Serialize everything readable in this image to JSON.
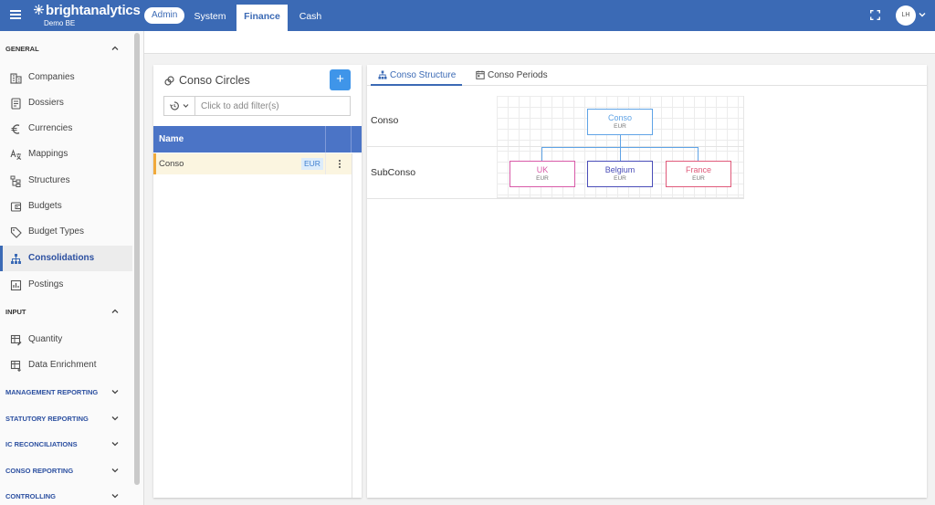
{
  "brand": {
    "name": "brightanalytics",
    "subtitle": "Demo BE"
  },
  "topbar": {
    "admin_label": "Admin",
    "tabs": [
      {
        "label": "System",
        "active": false
      },
      {
        "label": "Finance",
        "active": true
      },
      {
        "label": "Cash",
        "active": false
      }
    ],
    "user_initials": "LH"
  },
  "sidebar": {
    "general_title": "GENERAL",
    "general_items": [
      {
        "label": "Companies",
        "icon": "building-icon"
      },
      {
        "label": "Dossiers",
        "icon": "document-list-icon"
      },
      {
        "label": "Currencies",
        "icon": "euro-icon"
      },
      {
        "label": "Mappings",
        "icon": "translate-icon"
      },
      {
        "label": "Structures",
        "icon": "file-tree-icon"
      },
      {
        "label": "Budgets",
        "icon": "wallet-icon"
      },
      {
        "label": "Budget Types",
        "icon": "tag-icon"
      },
      {
        "label": "Consolidations",
        "icon": "hierarchy-icon",
        "active": true
      },
      {
        "label": "Postings",
        "icon": "chart-box-icon"
      }
    ],
    "input_title": "INPUT",
    "input_items": [
      {
        "label": "Quantity",
        "icon": "table-edit-icon"
      },
      {
        "label": "Data Enrichment",
        "icon": "table-plus-icon"
      }
    ],
    "collapsed_sections": [
      "MANAGEMENT REPORTING",
      "STATUTORY REPORTING",
      "IC RECONCILIATIONS",
      "CONSO REPORTING",
      "CONTROLLING"
    ]
  },
  "left_panel": {
    "title": "Conso Circles",
    "add_label": "+",
    "filter_placeholder": "Click to add filter(s)",
    "table": {
      "column_name": "Name",
      "rows": [
        {
          "name": "Conso",
          "currency": "EUR",
          "selected": true
        }
      ]
    }
  },
  "right_panel": {
    "tabs": [
      {
        "label": "Conso Structure",
        "active": true
      },
      {
        "label": "Conso Periods",
        "active": false
      }
    ],
    "levels": [
      "Conso",
      "SubConso"
    ],
    "root": {
      "name": "Conso",
      "currency": "EUR",
      "color": "#5fa3e6"
    },
    "children": [
      {
        "name": "UK",
        "currency": "EUR",
        "color": "#d85aa8"
      },
      {
        "name": "Belgium",
        "currency": "EUR",
        "color": "#4a4db8"
      },
      {
        "name": "France",
        "currency": "EUR",
        "color": "#e05a7a"
      }
    ]
  },
  "colors": {
    "primary": "#3b6ab5",
    "accent_button": "#3f95e9",
    "selected_row_marker": "#f0a93a"
  }
}
